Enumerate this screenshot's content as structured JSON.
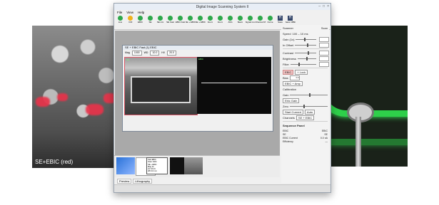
{
  "left_image": {
    "caption": "SE+EBIC (red)"
  },
  "window": {
    "title": "Digital Image Scanning System II",
    "controls": [
      "–",
      "□",
      "×"
    ],
    "menu": [
      "File",
      "View",
      "Help"
    ],
    "toolbar": [
      {
        "label": "Live",
        "color": "#2ea84a"
      },
      {
        "label": "FOF",
        "color": "#f0b21b"
      },
      {
        "label": "EBIC",
        "color": "#2ea84a"
      },
      {
        "label": "SE",
        "color": "#2ea84a"
      },
      {
        "label": "SE mix",
        "color": "#2ea84a"
      },
      {
        "label": "SE Fast",
        "color": "#2ea84a"
      },
      {
        "label": "EBIC Fast",
        "color": "#2ea84a"
      },
      {
        "label": "SE + EBIC Fast",
        "color": "#2ea84a"
      },
      {
        "label": "SE + EBIC pixel",
        "color": "#2ea84a"
      },
      {
        "label": "Zoom",
        "color": "#2ea84a"
      },
      {
        "label": "Zoom",
        "color": "#2ea84a"
      },
      {
        "label": "AVG",
        "color": "#2ea84a"
      },
      {
        "label": "Beam",
        "color": "#2ea84a"
      },
      {
        "label": "Signal monitor",
        "color": "#2ea84a"
      },
      {
        "label": "Channel Mixer",
        "color": "#2ea84a"
      },
      {
        "label": "Curve",
        "color": "#2ea84a"
      }
    ],
    "toolbar_save": [
      {
        "label": "Save",
        "glyph": "H"
      },
      {
        "label": "Save 16Bit",
        "glyph": "H"
      }
    ],
    "child": {
      "title": "SE + EBIC Fast (1)  EBIC",
      "mag_label": "Mag",
      "mag_value": "1000",
      "wd_label": "WD",
      "wd_value": "10.0",
      "hv_label": "HV",
      "hv_value": "20.0",
      "left_tag": "SE",
      "right_tag": "EBIC"
    },
    "thumb_popup": [
      "Fast EBIC",
      "Scan 1024",
      "SE + EBIC",
      "Mag 1k",
      "HV 20 kV",
      "WD 10 mm"
    ],
    "tabs": [
      "Preview",
      "Lithography"
    ],
    "right_panel": {
      "header": [
        "Scanner",
        "Scan"
      ],
      "speed_label": "Speed",
      "speed_value": "100 – 10 ms",
      "gain_label": "Gain (1x)",
      "offset_label": "In Offset",
      "contrast_label": "Contrast",
      "brightness_label": "Brightness",
      "filter_label": "Filter",
      "ebic_button": "EBIC",
      "lock_button": "+ Lock",
      "bias_label": "Bias",
      "bias_value": "0.0",
      "ebic_amp_button": "EBIC + Amp",
      "cal_label": "Calibration",
      "gain2_label": "Gain",
      "ebic_gain_button": "Ebic Gain",
      "zero_label": "Zero",
      "auto_button": "Start Current",
      "auto2_button": "Auto",
      "chan_label": "Channels",
      "chan_btn": "SE + EBIC",
      "table_title": "Sequence Panel",
      "table": [
        {
          "k": "EBIC",
          "v": "EBIC"
        },
        {
          "k": "SE",
          "v": "SE"
        },
        {
          "k": "EBIC Current",
          "v": "0.0 nA"
        },
        {
          "k": "Efficiency",
          "v": "—"
        }
      ]
    }
  },
  "colors": {
    "ebic_red": "#e8334a",
    "green_glow": "#2ed04a",
    "toolbar_blue": "#34466a"
  }
}
